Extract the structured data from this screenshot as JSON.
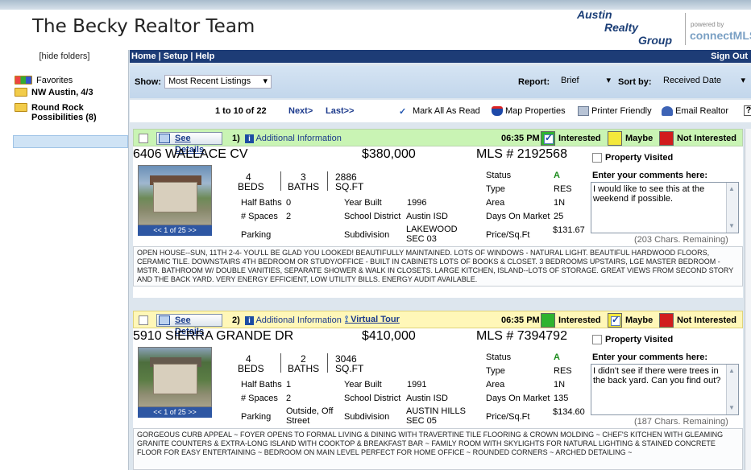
{
  "header": {
    "brand": "The Becky Realtor Team",
    "logo_lines": [
      "Austin",
      "Realty",
      "Group"
    ],
    "powered_by": "powered by",
    "cmls": "connectMLS"
  },
  "sidebar": {
    "hide_folders": "[hide folders]",
    "folders": [
      {
        "label": "Favorites"
      },
      {
        "label": "NW Austin, 4/3"
      },
      {
        "label": "Round Rock\nPossibilities (8)"
      }
    ]
  },
  "nav": {
    "left": "Home | Setup | Help",
    "signout": "Sign Out"
  },
  "toolbar": {
    "show_label": "Show:",
    "show_value": "Most Recent Listings",
    "report_label": "Report:",
    "report_value": "Brief",
    "sort_label": "Sort by:",
    "sort_value": "Received Date"
  },
  "pager": {
    "range": "1 to 10 of 22",
    "next": "Next>",
    "last": "Last>>",
    "mark_all": "Mark All As Read",
    "map": "Map Properties",
    "printer": "Printer Friendly",
    "email": "Email Realtor",
    "help": "?"
  },
  "listings": [
    {
      "see_details": "See Details",
      "num": "1)",
      "info_i": "i",
      "additional": "Additional Information",
      "time": "06:35 PM",
      "interested": "Interested",
      "maybe": "Maybe",
      "not_interested": "Not Interested",
      "street": "6406 WALLACE CV",
      "price": "$380,000",
      "mls": "MLS # 2192568",
      "visited": "Property Visited",
      "beds": "4",
      "beds_l": "BEDS",
      "baths": "3",
      "baths_l": "BATHS",
      "sqft": "2886",
      "sqft_l": "SQ.FT",
      "half_baths_l": "Half Baths",
      "half_baths": "0",
      "spaces_l": "# Spaces",
      "spaces": "2",
      "parking_l": "Parking",
      "parking": "",
      "year_l": "Year Built",
      "year": "1996",
      "school_l": "School District",
      "school": "Austin ISD",
      "subdiv_l": "Subdivision",
      "subdiv": "LAKEWOOD SEC 03",
      "status_l": "Status",
      "status": "A",
      "type_l": "Type",
      "type": "RES",
      "area_l": "Area",
      "area": "1N",
      "dom_l": "Days On Market",
      "dom": "25",
      "ppsf_l": "Price/Sq.Ft",
      "ppsf": "$131.67",
      "photos": "<< 1 of 25 >>",
      "cmt_label": "Enter your comments here:",
      "comment": "I would like to see this at the weekend if possible.",
      "remaining": "(203 Chars. Remaining)",
      "desc": "OPEN HOUSE--SUN, 11TH 2-4- YOU'LL BE GLAD YOU LOOKED! BEAUTIFULLY MAINTAINED. LOTS OF WINDOWS - NATURAL LIGHT. BEAUTIFUL HARDWOOD FLOORS, CERAMIC TILE. DOWNSTAIRS 4TH BEDROOM OR STUDY/OFFICE - BUILT IN CABINETS LOTS OF BOOKS & CLOSET. 3 BEDROOMS UPSTAIRS, LGE MASTER BEDROOM - MSTR. BATHROOM W/ DOUBLE VANITIES, SEPARATE SHOWER & WALK IN CLOSETS. LARGE KITCHEN, ISLAND--LOTS OF STORAGE. GREAT VIEWS FROM SECOND STORY AND THE BACK YARD. VERY ENERGY EFFICIENT, LOW UTILITY BILLS. ENERGY AUDIT AVAILABLE."
    },
    {
      "see_details": "See Details",
      "num": "2)",
      "info_i": "i",
      "additional": "Additional Information",
      "virtual_tour": "Virtual Tour",
      "time": "06:35 PM",
      "interested": "Interested",
      "maybe": "Maybe",
      "not_interested": "Not Interested",
      "street": "5910 SIERRA GRANDE DR",
      "price": "$410,000",
      "mls": "MLS # 7394792",
      "visited": "Property Visited",
      "beds": "4",
      "beds_l": "BEDS",
      "baths": "2",
      "baths_l": "BATHS",
      "sqft": "3046",
      "sqft_l": "SQ.FT",
      "half_baths_l": "Half Baths",
      "half_baths": "1",
      "spaces_l": "# Spaces",
      "spaces": "2",
      "parking_l": "Parking",
      "parking": "Outside, Off Street",
      "year_l": "Year Built",
      "year": "1991",
      "school_l": "School District",
      "school": "Austin ISD",
      "subdiv_l": "Subdivision",
      "subdiv": "AUSTIN HILLS SEC 05",
      "status_l": "Status",
      "status": "A",
      "type_l": "Type",
      "type": "RES",
      "area_l": "Area",
      "area": "1N",
      "dom_l": "Days On Market",
      "dom": "135",
      "ppsf_l": "Price/Sq.Ft",
      "ppsf": "$134.60",
      "photos": "<< 1 of 25 >>",
      "cmt_label": "Enter your comments here:",
      "comment": "I didn't see if there were trees in the back yard. Can you find out?",
      "remaining": "(187 Chars. Remaining)",
      "desc": "GORGEOUS CURB APPEAL ~ FOYER OPENS TO FORMAL LIVING & DINING WITH TRAVERTINE TILE FLOORING & CROWN MOLDING ~ CHEF'S KITCHEN WITH GLEAMING GRANITE COUNTERS & EXTRA-LONG ISLAND WITH COOKTOP & BREAKFAST BAR ~ FAMILY ROOM WITH SKYLIGHTS FOR NATURAL LIGHTING & STAINED CONCRETE FLOOR FOR EASY ENTERTAINING ~ BEDROOM ON MAIN LEVEL PERFECT FOR HOME OFFICE ~ ROUNDED CORNERS ~ ARCHED DETAILING ~"
    }
  ]
}
